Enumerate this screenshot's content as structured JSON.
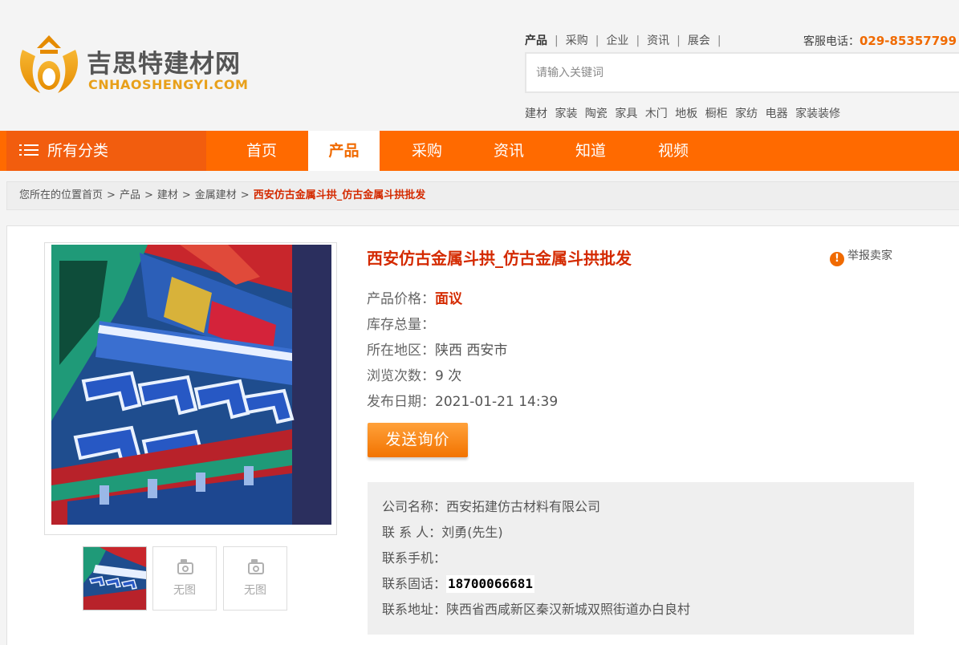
{
  "header": {
    "logo_text": "吉思特建材网",
    "logo_sub": "CNHAOSHENGYI.COM",
    "top_tabs": [
      "产品",
      "采购",
      "企业",
      "资讯",
      "展会"
    ],
    "top_tabs_active": "产品",
    "hotline_label": "客服电话：",
    "hotline_number": "029-85357799",
    "search_placeholder": "请输入关键词",
    "hot_words": [
      "建材",
      "家装",
      "陶瓷",
      "家具",
      "木门",
      "地板",
      "橱柜",
      "家纺",
      "电器",
      "家装装修"
    ]
  },
  "nav": {
    "all_categories": "所有分类",
    "items": [
      "首页",
      "产品",
      "采购",
      "资讯",
      "知道",
      "视频"
    ],
    "active": "产品"
  },
  "breadcrumb": {
    "prefix": "您所在的位置",
    "items": [
      "首页",
      "产品",
      "建材",
      "金属建材"
    ],
    "current": "西安仿古金属斗拱_仿古金属斗拱批发"
  },
  "product": {
    "title": "西安仿古金属斗拱_仿古金属斗拱批发",
    "report_label": "举报卖家",
    "price_label": "产品价格：",
    "price_value": "面议",
    "stock_label": "库存总量：",
    "stock_value": "",
    "region_label": "所在地区：",
    "region_value": "陕西 西安市",
    "views_label": "浏览次数：",
    "views_value": "9 次",
    "date_label": "发布日期：",
    "date_value": "2021-01-21 14:39",
    "inquire_button": "发送询价",
    "thumbs": [
      {
        "type": "image"
      },
      {
        "type": "none",
        "label": "无图"
      },
      {
        "type": "none",
        "label": "无图"
      }
    ]
  },
  "company": {
    "name_label": "公司名称：",
    "name_value": "西安拓建仿古材料有限公司",
    "contact_label": "联 系 人：",
    "contact_value": "刘勇(先生)",
    "mobile_label": "联系手机：",
    "mobile_value": "",
    "phone_label": "联系固话：",
    "phone_value": "18700066681",
    "address_label": "联系地址：",
    "address_value": "陕西省西咸新区秦汉新城双照街道办白良村"
  },
  "colors": {
    "brand_orange": "#ff6a00",
    "title_red": "#d42a00",
    "logo_gold": "#e8a01a"
  }
}
